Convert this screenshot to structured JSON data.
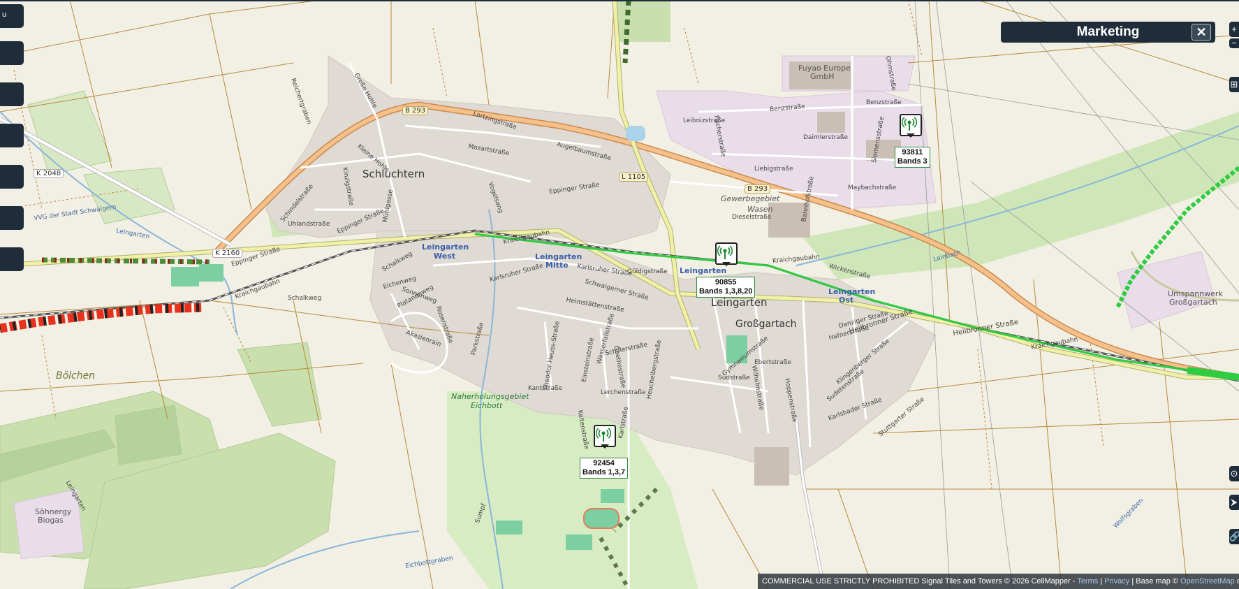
{
  "panel": {
    "title": "Marketing",
    "close_label": "✕"
  },
  "left_buttons": [
    {
      "label": "u"
    },
    {
      "label": ""
    },
    {
      "label": ""
    },
    {
      "label": ""
    },
    {
      "label": ""
    },
    {
      "label": ""
    },
    {
      "label": ""
    }
  ],
  "right_buttons": [
    {
      "label": "+"
    },
    {
      "label": "−"
    },
    {
      "label": "⊞"
    },
    {
      "label": "⊙"
    },
    {
      "label": "⮞"
    },
    {
      "label": "🔗"
    }
  ],
  "towers": [
    {
      "id": "93811",
      "bands": "Bands 3"
    },
    {
      "id": "90855",
      "bands": "Bands 1,3,8,20"
    },
    {
      "id": "92454",
      "bands": "Bands 1,3,7"
    }
  ],
  "places": {
    "leingarten": "Leingarten",
    "schluchtern": "Schluchtern",
    "grossgartach": "Großgartach",
    "bolchen": "Bölchen",
    "gewerbegebiet": "Gewerbegebiet",
    "wasen": "Wasen",
    "fuyao1": "Fuyao Europe",
    "fuyao2": "GmbH",
    "naherholung1": "Naherholungsgebiet",
    "naherholung2": "Eichbott",
    "umspannwerk1": "Umspannwerk",
    "umspannwerk2": "Großgartach",
    "sohnergy1": "Söhnergy",
    "sohnergy2": "Biogas"
  },
  "stations": {
    "west1": "Leingarten",
    "west2": "West",
    "mitte1": "Leingarten",
    "mitte2": "Mitte",
    "main": "Leingarten",
    "ost1": "Leingarten",
    "ost2": "Ost"
  },
  "roads": {
    "b293a": "B 293",
    "b293b": "B 293",
    "l1105": "L 1105",
    "k2048": "K 2048",
    "k2160": "K 2160"
  },
  "streets": {
    "s1": "Eppinger Straße",
    "s2": "Eppinger Straße",
    "s3": "Eppinger Straße",
    "s4": "Lortzingstraße",
    "s5": "Mozartstraße",
    "s6": "Augelbaumstraße",
    "s7": "Uhlandstraße",
    "s8": "Schalkweg",
    "s9": "Karlsruher Straße",
    "s10": "Karlsruher Straße",
    "s11": "Güldigstraße",
    "s12": "Schwaigerner Straße",
    "s13": "Heimstättenstraße",
    "s14": "Schillerstraße",
    "s15": "Lerchenstraße",
    "s16": "Kantstraße",
    "s17": "Heilbronner Straße",
    "s18": "Heilbronner Straße",
    "s19": "Benzstraße",
    "s20": "Benzstraße",
    "s21": "Daimlerstraße",
    "s22": "Liebigstraße",
    "s23": "Maybachstraße",
    "s24": "Dieselstraße",
    "s25": "Leibnizstraße",
    "s26": "Kraichgaubahn",
    "s27": "Kraichgaubahn",
    "s28": "Kraichgaubahn",
    "s29": "Kraichgaubahn",
    "s30": "Schalkweg",
    "s31": "Platanenweg",
    "s32": "Akazienrain",
    "s33": "Hafnerstraße",
    "s34": "Danziger Straße",
    "s35": "Klingenberger Straße",
    "s36": "Sudetenstraße",
    "s37": "Karlsbader Straße",
    "s38": "Stuttgarter Straße",
    "s39": "Südstraße",
    "s40": "Wilhelmstraße",
    "s41": "Hoppenstraße",
    "s42": "Ebertstraße",
    "s43": "Gymnasiumstraße",
    "s44": "Eichbottgraben",
    "s45": "Wolfsgraben",
    "s46": "Leinbach",
    "s47": "Reichertgraben",
    "s48": "Große Hohle",
    "s49": "Kleine Hohle",
    "s50": "Kinzigstraße",
    "s51": "Mühlgasse",
    "s52": "Schindelstraße",
    "s53": "Sonnenweg",
    "s54": "Rosenstraße",
    "s55": "Theodor-Heuss-Straße",
    "s56": "Einsteinstraße",
    "s57": "Goethestraße",
    "s58": "Heuchelbergstraße",
    "s59": "Karlstraße",
    "s60": "Ohmstraße",
    "s61": "Siemensstraße",
    "s62": "Fischerstraße",
    "s63": "Wickenstraße",
    "s64": "Eichenweg",
    "s65": "Bahnhofstraße",
    "s66": "Sumpf",
    "s67": "Leingarten",
    "s68": "Parkstraße",
    "s69": "Wasserfallstraße",
    "s70": "Keltenstraße",
    "s71": "Vogelsang",
    "s72": "VVG der Stadt Schwaigern",
    "s73": "Leingarten"
  },
  "footer": {
    "notice": "COMMERCIAL USE STRICTLY PROHIBITED Signal Tiles and Towers © 2026 CellMapper - ",
    "terms": "Terms",
    "sep1": " | ",
    "privacy": "Privacy",
    "sep2": " | Base map © ",
    "osm": "OpenStreetMap",
    "tail": " contributors"
  },
  "colors": {
    "panel": "#1f2d3a",
    "signal_green": "#2ecc40",
    "signal_red": "#e8321e",
    "major_road": "#f5c08a",
    "secondary_road": "#f0f0a8",
    "residential": "#dcd6d0",
    "farmland": "#f2efe4",
    "vineyard": "#b5d29a",
    "field_border": "#b88a3a",
    "rail": "#666666"
  }
}
